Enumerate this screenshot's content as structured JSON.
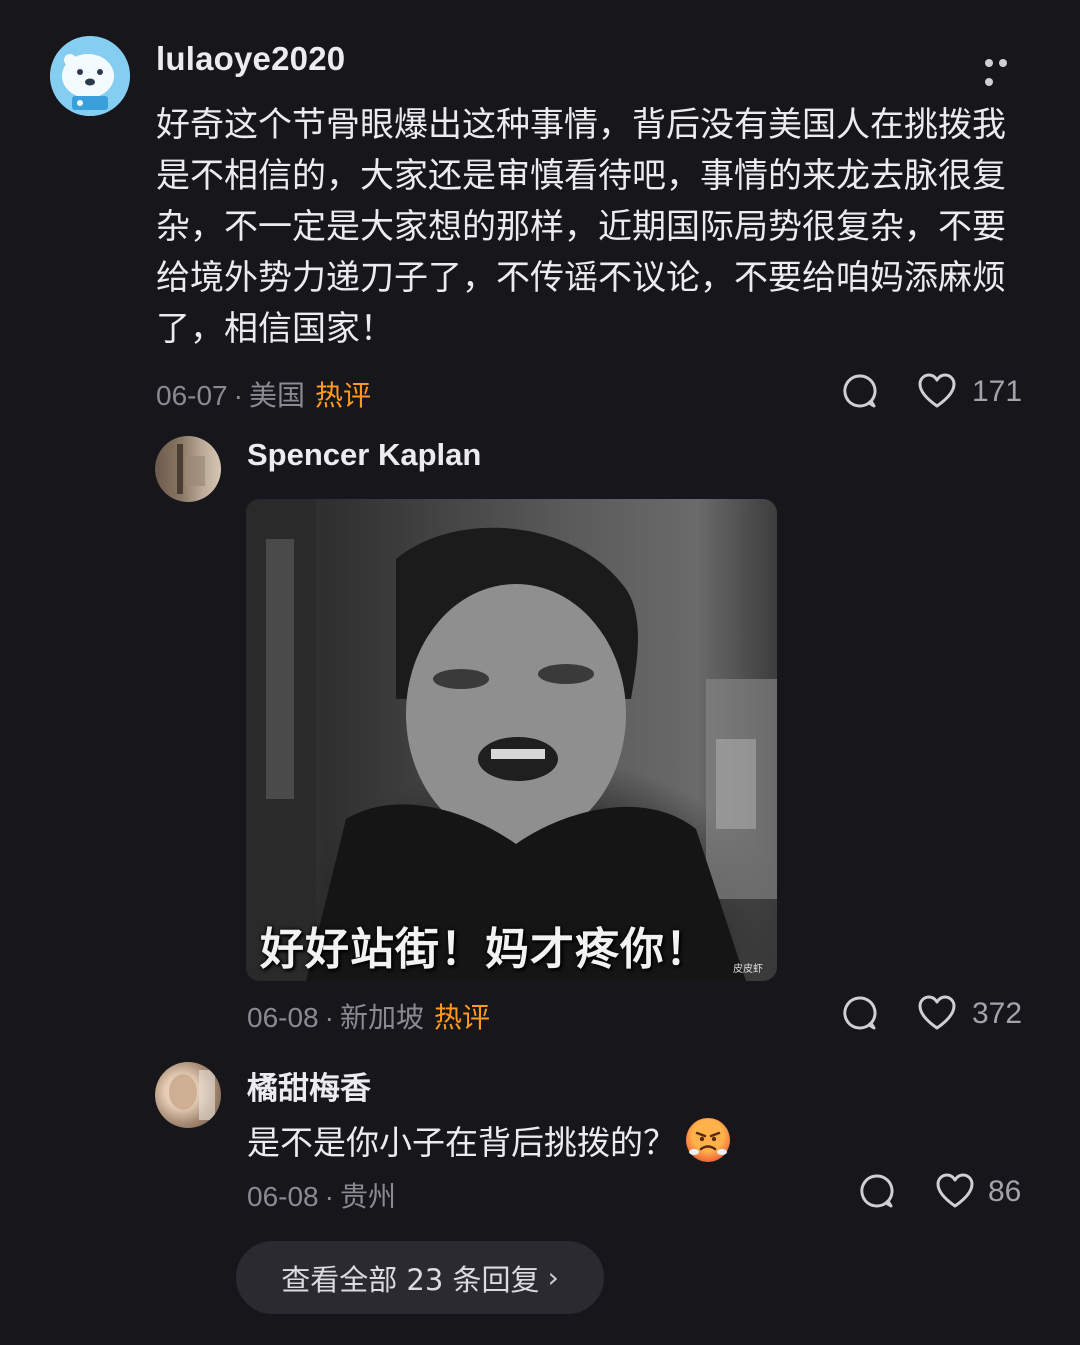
{
  "post": {
    "username": "lulaoye2020",
    "body": "好奇这个节骨眼爆出这种事情，背后没有美国人在挑拨我是不相信的，大家还是审慎看待吧，事情的来龙去脉很复杂，不一定是大家想的那样，近期国际局势很复杂，不要给境外势力递刀子了，不传谣不议论，不要给咱妈添麻烦了，相信国家！",
    "date": "06-07",
    "separator": "·",
    "region": "美国",
    "hot_tag": "热评",
    "like_count": "171"
  },
  "replies": [
    {
      "username": "Spencer Kaplan",
      "image_caption": "好好站街！妈才疼你！",
      "image_watermark": "皮皮虾",
      "date": "06-08",
      "separator": "·",
      "region": "新加坡",
      "hot_tag": "热评",
      "like_count": "372"
    },
    {
      "username": "橘甜梅香",
      "text": "是不是你小子在背后挑拨的？",
      "emoji": "angry-face-emoji",
      "date": "06-08",
      "separator": "·",
      "region": "贵州",
      "like_count": "86"
    }
  ],
  "view_all": {
    "label": "查看全部 23 条回复",
    "chevron": "›"
  },
  "colors": {
    "background": "#17171b",
    "text": "#ececef",
    "meta": "#8a8a92",
    "hot": "#ff9a1f",
    "button_bg": "#2a2a30"
  }
}
